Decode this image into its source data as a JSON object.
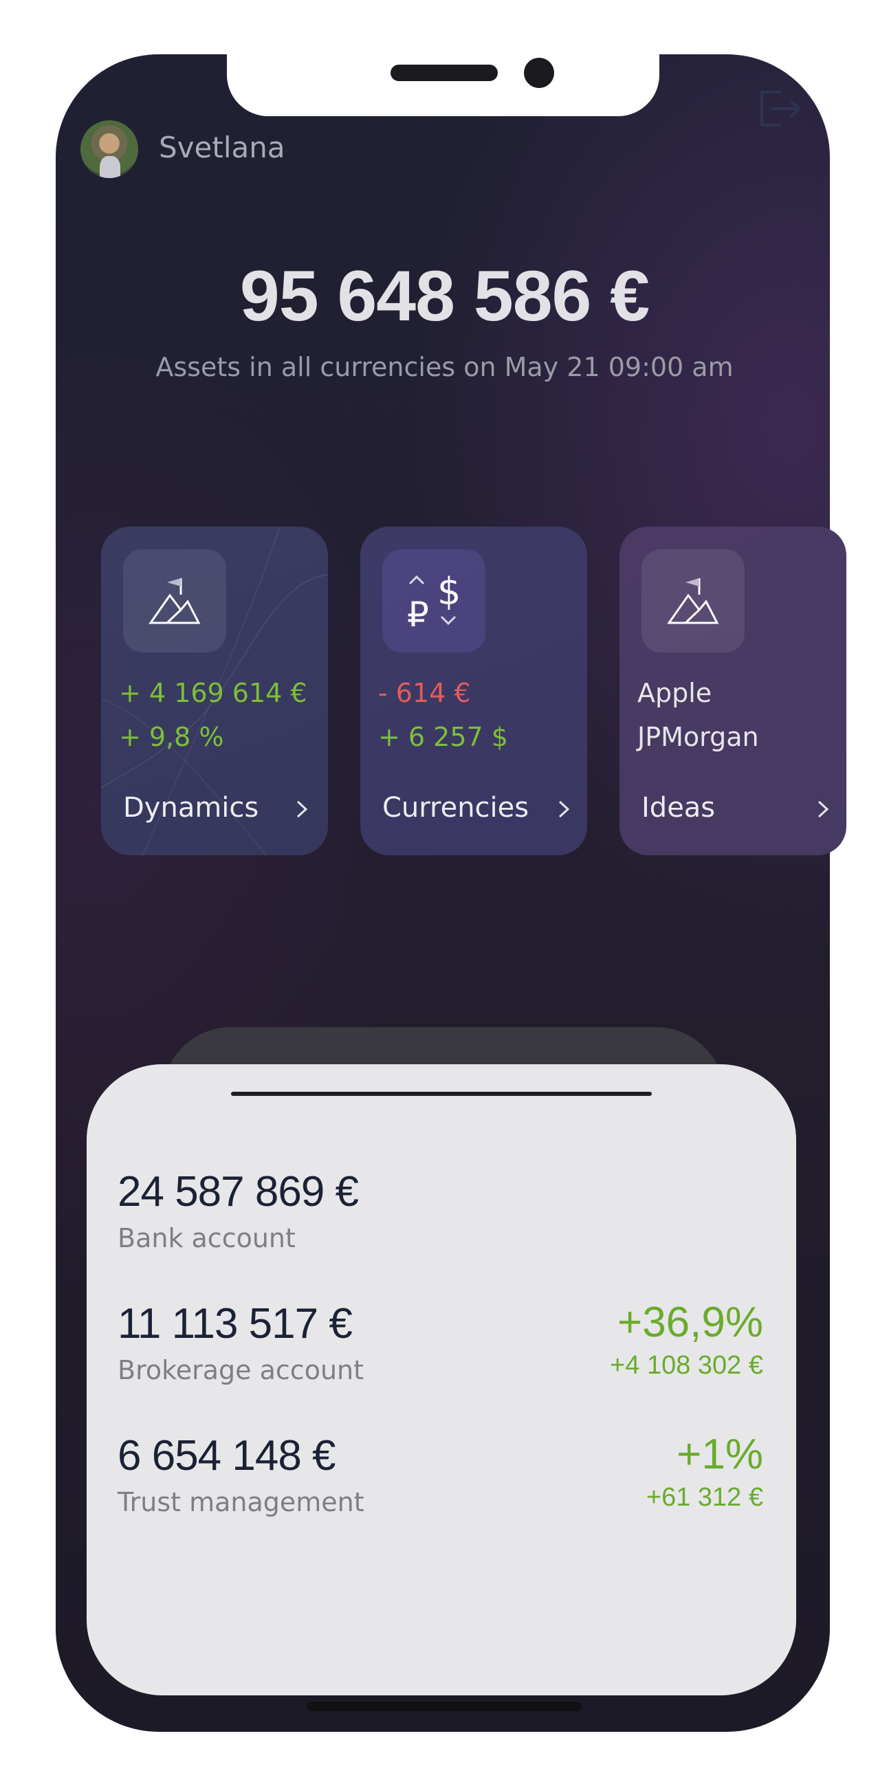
{
  "user": {
    "name": "Svetlana"
  },
  "summary": {
    "total": "95 648 586 €",
    "caption": "Assets in all currencies on May 21 09:00 am"
  },
  "cards": [
    {
      "line1": "+ 4 169 614 €",
      "line2": "+ 9,8 %",
      "label": "Dynamics",
      "icon": "mountain-flag-icon"
    },
    {
      "line1": "- 614 €",
      "line2": "+ 6 257 $",
      "label": "Currencies",
      "icon": "currency-exchange-icon"
    },
    {
      "line1": "Apple",
      "line2": "JPMorgan",
      "label": "Ideas",
      "icon": "mountain-flag-icon"
    }
  ],
  "accounts": [
    {
      "amount": "24 587 869 €",
      "name": "Bank account"
    },
    {
      "amount": "11 113 517 €",
      "name": "Brokerage account",
      "change_pct": "+36,9%",
      "change_abs": "+4 108 302 €"
    },
    {
      "amount": "6 654 148 €",
      "name": "Trust management",
      "change_pct": "+1%",
      "change_abs": "+61 312 €"
    }
  ],
  "colors": {
    "positive": "#7dbf3a",
    "negative": "#e25c5c",
    "background": "#221f31",
    "sheet": "#e7e7e9"
  },
  "icons": {
    "logout": "logout-icon",
    "chevron": "chevron-right-icon"
  }
}
